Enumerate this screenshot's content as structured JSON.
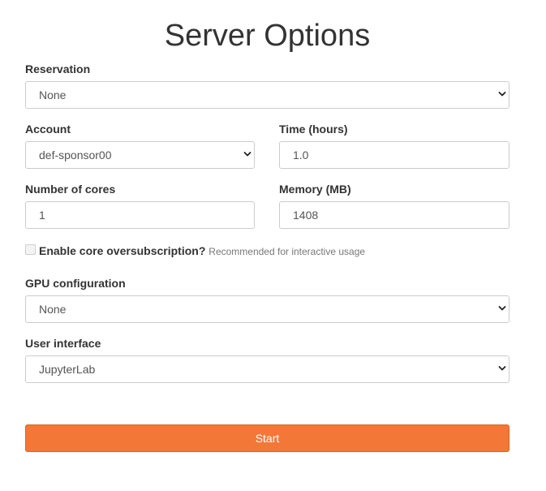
{
  "page": {
    "title": "Server Options"
  },
  "form": {
    "reservation": {
      "label": "Reservation",
      "value": "None"
    },
    "account": {
      "label": "Account",
      "value": "def-sponsor00"
    },
    "time": {
      "label": "Time (hours)",
      "value": "1.0"
    },
    "cores": {
      "label": "Number of cores",
      "value": "1"
    },
    "memory": {
      "label": "Memory (MB)",
      "value": "1408"
    },
    "oversubscription": {
      "label": "Enable core oversubscription?",
      "help": "Recommended for interactive usage",
      "checked": false
    },
    "gpu": {
      "label": "GPU configuration",
      "value": "None"
    },
    "ui": {
      "label": "User interface",
      "value": "JupyterLab"
    },
    "submit_label": "Start"
  },
  "colors": {
    "accent": "#f37838",
    "text": "#333333",
    "border": "#cccccc"
  }
}
